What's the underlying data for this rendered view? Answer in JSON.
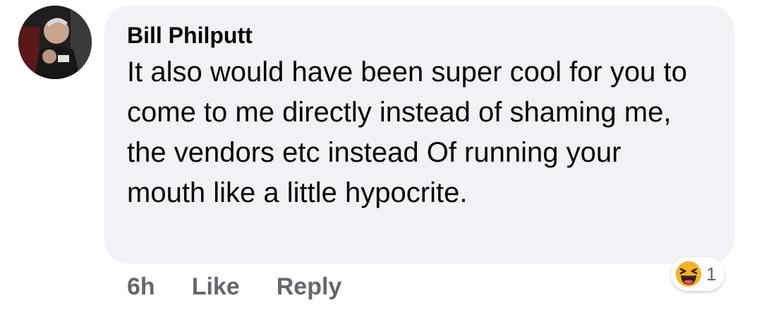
{
  "comment": {
    "author": "Bill Philputt",
    "text": "It also would have been super cool for you to come to me directly instead of shaming me, the vendors etc instead Of running your mouth like a little hypocrite.",
    "timestamp": "6h",
    "actions": {
      "like_label": "Like",
      "reply_label": "Reply"
    },
    "reaction": {
      "icon": "laughing-face-icon",
      "count": "1"
    }
  },
  "colors": {
    "bubble_background": "#f0f2f5",
    "text_primary": "#050505",
    "text_secondary": "#65676b",
    "reaction_yellow": "#f7b125"
  }
}
